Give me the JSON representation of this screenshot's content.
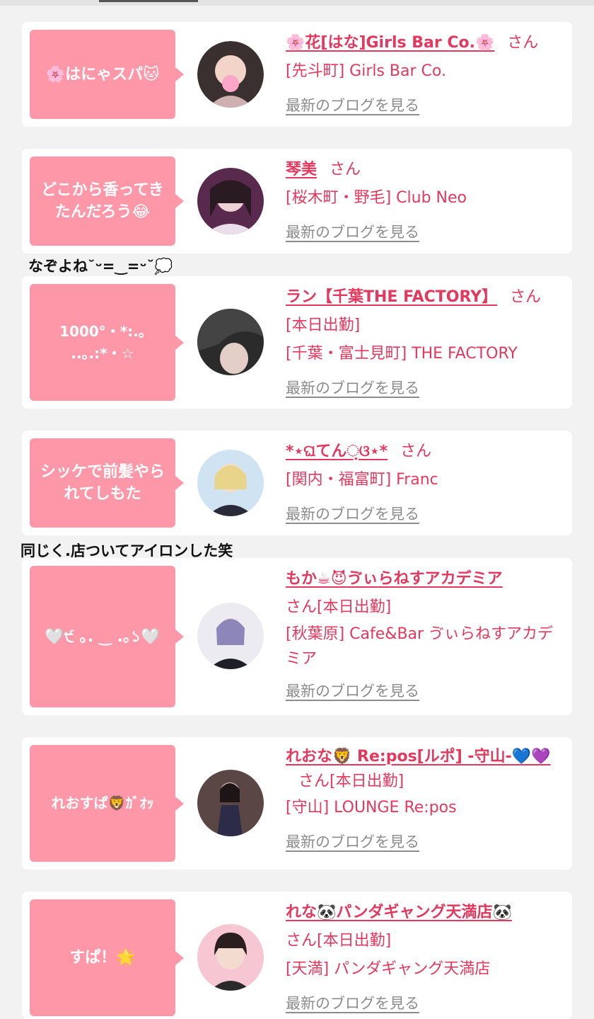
{
  "colors": {
    "accent": "#e4395e",
    "bubble": "#fe98a8",
    "link_gray": "#8c8c8c"
  },
  "cards": [
    {
      "message": "🌸はにゃスパ🐱",
      "name": "🌸花[はな]Girls Bar Co.🌸",
      "san": "さん",
      "lines": [
        "[先斗町] Girls Bar Co."
      ],
      "blog": "最新のブログを見る",
      "avatar": "avatar-photo-icon"
    },
    {
      "message": "どこから香ってきたんだろう😂",
      "name": "琴美",
      "san": "さん",
      "lines": [
        "[桜木町・野毛] Club Neo"
      ],
      "blog": "最新のブログを見る",
      "avatar": "avatar-photo-icon"
    },
    {
      "message": "1000°・*:.｡ ..｡.:*・☆",
      "name": "ラン【千葉THE FACTORY】",
      "san": "さん",
      "lines": [
        "[本日出勤]",
        "[千葉・富士見町] THE FACTORY"
      ],
      "blog": "最新のブログを見る",
      "avatar": "avatar-photo-icon"
    },
    {
      "message": "シッケで前髪やられてしもた",
      "name": "*⋆ଘてん଼ଓ⋆*",
      "san": "さん",
      "lines": [
        "[関内・福富町] Franc"
      ],
      "blog": "最新のブログを見る",
      "avatar": "avatar-photo-icon"
    },
    {
      "message": "🤍੯ ｡. ‿ .｡১🤍",
      "name": "もか☕😈ゔぃらねすアカデミア",
      "san": "さん[本日出勤]",
      "lines": [
        "[秋葉原] Cafe&Bar ゔぃらねすアカデミア"
      ],
      "blog": "最新のブログを見る",
      "avatar": "avatar-photo-icon"
    },
    {
      "message": "れおすぱ🦁ｶﾞｵｯ",
      "name": "れおな🦁 Re:pos[ルポ] -守山-💙💜",
      "san": "さん[本日出勤]",
      "lines": [
        "[守山] LOUNGE Re:pos"
      ],
      "blog": "最新のブログを見る",
      "avatar": "avatar-photo-icon"
    },
    {
      "message": "すぱ！🌟",
      "name": "れな🐼パンダギャング天満店🐼",
      "san": "さん[本日出勤]",
      "lines": [
        "[天満] パンダギャング天満店"
      ],
      "blog": "最新のブログを見る",
      "avatar": "avatar-photo-icon"
    }
  ],
  "comments": [
    {
      "text": "なぞよね˘ᵕ=‿=ᵕ˘💭"
    },
    {
      "text": "同じく.店ついてアイロンした笑"
    }
  ]
}
